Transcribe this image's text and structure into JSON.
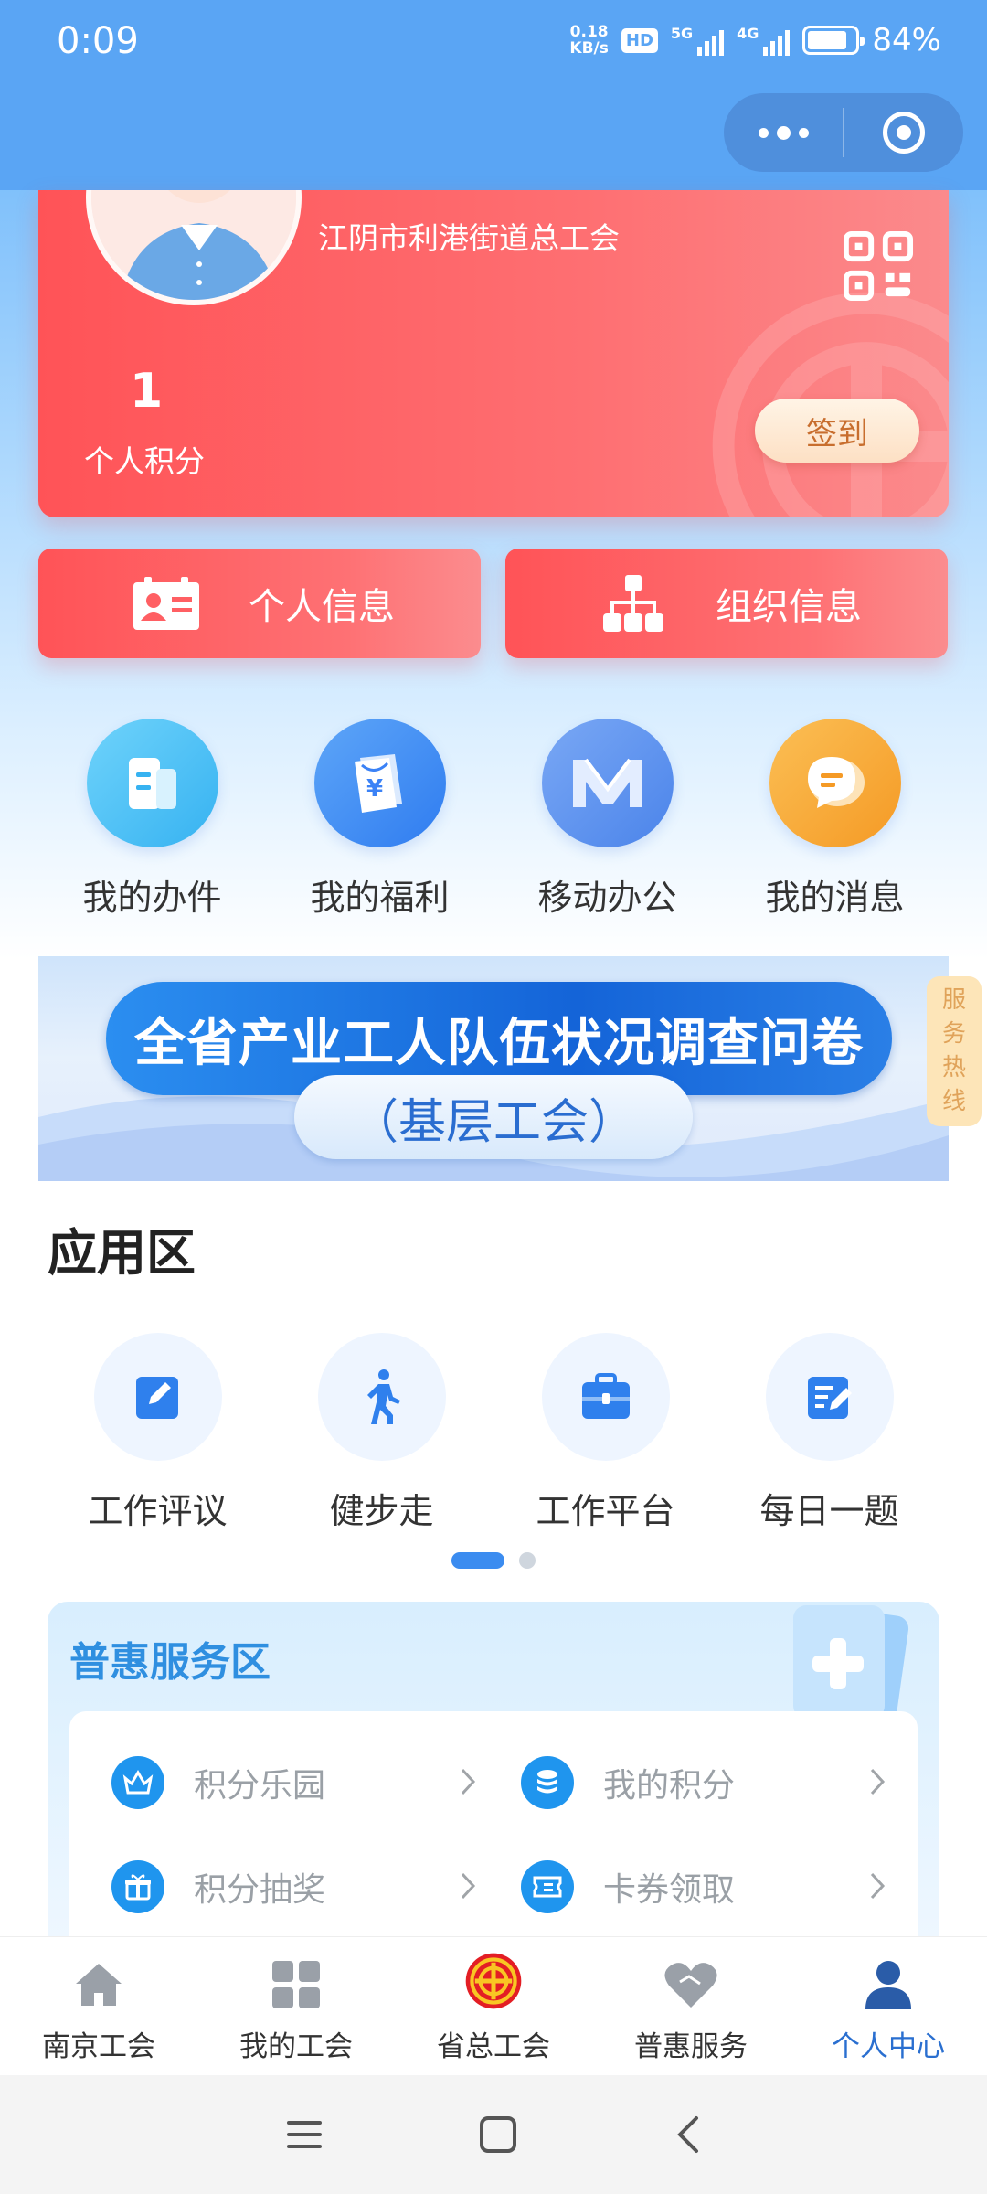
{
  "status_bar": {
    "time": "0:09",
    "net_speed_value": "0.18",
    "net_speed_unit": "KB/s",
    "hd_badge": "HD",
    "network_1": "5G",
    "network_2": "4G",
    "battery_percent": "84%",
    "battery_level": 0.84
  },
  "profile": {
    "union_name": "江阴市利港街道总工会",
    "points_value": "1",
    "points_label": "个人积分",
    "checkin_label": "签到"
  },
  "info_buttons": [
    {
      "label": "个人信息",
      "icon": "id-card-icon"
    },
    {
      "label": "组织信息",
      "icon": "org-chart-icon"
    }
  ],
  "quick_actions": [
    {
      "label": "我的办件",
      "icon": "document-icon",
      "color": "#4bc3f5"
    },
    {
      "label": "我的福利",
      "icon": "welfare-yen-icon",
      "color": "#3f8cf3"
    },
    {
      "label": "移动办公",
      "icon": "mobile-office-m-icon",
      "color": "#5a92ee"
    },
    {
      "label": "我的消息",
      "icon": "message-icon",
      "color": "#f7a93a"
    }
  ],
  "banner": {
    "title": "全省产业工人队伍状况调查问卷",
    "subtitle": "（基层工会）",
    "hotline_text": "服务热线"
  },
  "app_zone": {
    "title": "应用区",
    "items": [
      {
        "label": "工作评议",
        "icon": "edit-icon"
      },
      {
        "label": "健步走",
        "icon": "walking-icon"
      },
      {
        "label": "工作平台",
        "icon": "briefcase-icon"
      },
      {
        "label": "每日一题",
        "icon": "quiz-edit-icon"
      }
    ],
    "page_count": 2,
    "current_page": 1
  },
  "benefit_zone": {
    "title": "普惠服务区",
    "items": [
      {
        "label": "积分乐园",
        "icon": "crown-icon"
      },
      {
        "label": "我的积分",
        "icon": "coins-icon"
      },
      {
        "label": "积分抽奖",
        "icon": "gift-icon"
      },
      {
        "label": "卡券领取",
        "icon": "ticket-icon"
      }
    ]
  },
  "tab_bar": [
    {
      "label": "南京工会",
      "icon": "home-icon",
      "active": false
    },
    {
      "label": "我的工会",
      "icon": "grid-icon",
      "active": false
    },
    {
      "label": "省总工会",
      "icon": "union-emblem-icon",
      "active": false
    },
    {
      "label": "普惠服务",
      "icon": "heart-icon",
      "active": false
    },
    {
      "label": "个人中心",
      "icon": "person-icon",
      "active": true
    }
  ],
  "colors": {
    "primary_blue": "#5aa5f4",
    "card_red": "#ff5357",
    "active_tab": "#2a6fd0",
    "benefit_title": "#2f8fe0"
  }
}
